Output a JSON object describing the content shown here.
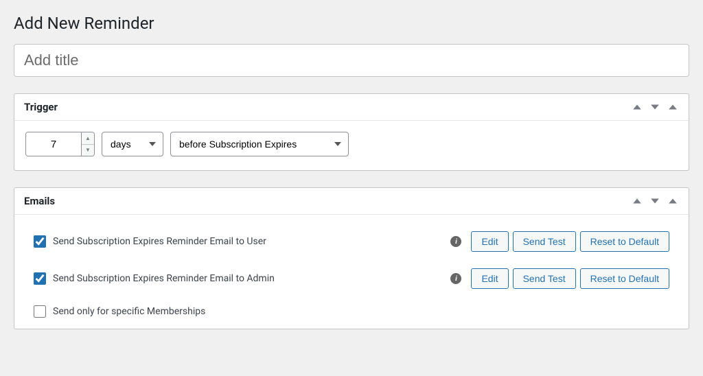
{
  "page": {
    "heading": "Add New Reminder"
  },
  "title_field": {
    "placeholder": "Add title",
    "value": ""
  },
  "trigger_box": {
    "title": "Trigger",
    "amount": "7",
    "unit": "days",
    "event": "before Subscription Expires"
  },
  "emails_box": {
    "title": "Emails",
    "rows": [
      {
        "checked": true,
        "label": "Send Subscription Expires Reminder Email to User",
        "edit": "Edit",
        "send_test": "Send Test",
        "reset": "Reset to Default"
      },
      {
        "checked": true,
        "label": "Send Subscription Expires Reminder Email to Admin",
        "edit": "Edit",
        "send_test": "Send Test",
        "reset": "Reset to Default"
      }
    ],
    "specific": {
      "checked": false,
      "label": "Send only for specific Memberships"
    }
  }
}
